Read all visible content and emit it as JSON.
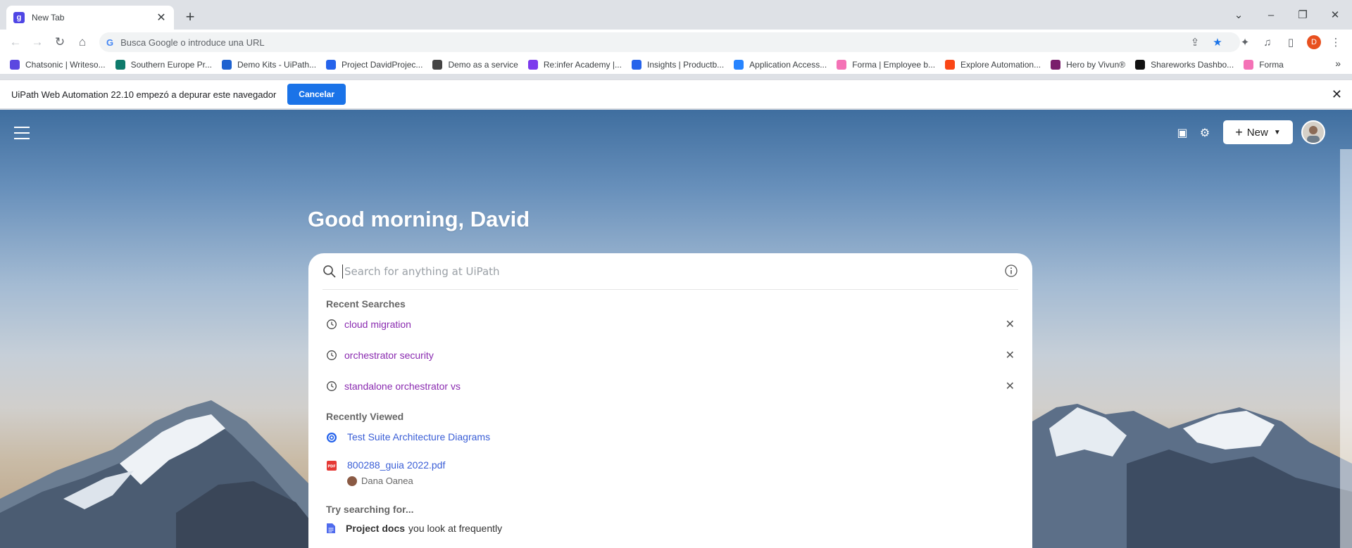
{
  "browser": {
    "tab_title": "New Tab",
    "tab_favicon_letter": "g",
    "omnibox_placeholder": "Busca Google o introduce una URL",
    "profile_initial": "D"
  },
  "bookmarks": [
    {
      "label": "Chatsonic | Writeso...",
      "color": "#5b47e0"
    },
    {
      "label": "Southern Europe Pr...",
      "color": "#0f7b6c"
    },
    {
      "label": "Demo Kits - UiPath...",
      "color": "#1e62d0"
    },
    {
      "label": "Project DavidProjec...",
      "color": "#2563eb"
    },
    {
      "label": "Demo as a service",
      "color": "#444444"
    },
    {
      "label": "Re:infer Academy |...",
      "color": "#7c3aed"
    },
    {
      "label": "Insights | Productb...",
      "color": "#2563eb"
    },
    {
      "label": "Application Access...",
      "color": "#2684ff"
    },
    {
      "label": "Forma | Employee b...",
      "color": "#f472b6"
    },
    {
      "label": "Explore Automation...",
      "color": "#fa4616"
    },
    {
      "label": "Hero by Vivun®",
      "color": "#7a1f6b"
    },
    {
      "label": "Shareworks Dashbo...",
      "color": "#111111"
    },
    {
      "label": "Forma",
      "color": "#f472b6"
    }
  ],
  "infobar": {
    "message": "UiPath Web Automation 22.10 empezó a depurar este navegador",
    "cancel_label": "Cancelar"
  },
  "page": {
    "greeting": "Good morning, David",
    "new_label": "New",
    "search_placeholder": "Search for anything at UiPath",
    "recent_searches_label": "Recent Searches",
    "recent_searches": [
      "cloud migration",
      "orchestrator security",
      "standalone orchestrator vs"
    ],
    "recently_viewed_label": "Recently Viewed",
    "recently_viewed": [
      {
        "title": "Test Suite Architecture Diagrams",
        "icon": "confluence-icon"
      },
      {
        "title": "800288_guia 2022.pdf",
        "icon": "pdf-icon",
        "owner": "Dana Oanea"
      }
    ],
    "try_label": "Try searching for...",
    "try_item": {
      "bold": "Project docs",
      "rest": "you look at frequently"
    }
  }
}
